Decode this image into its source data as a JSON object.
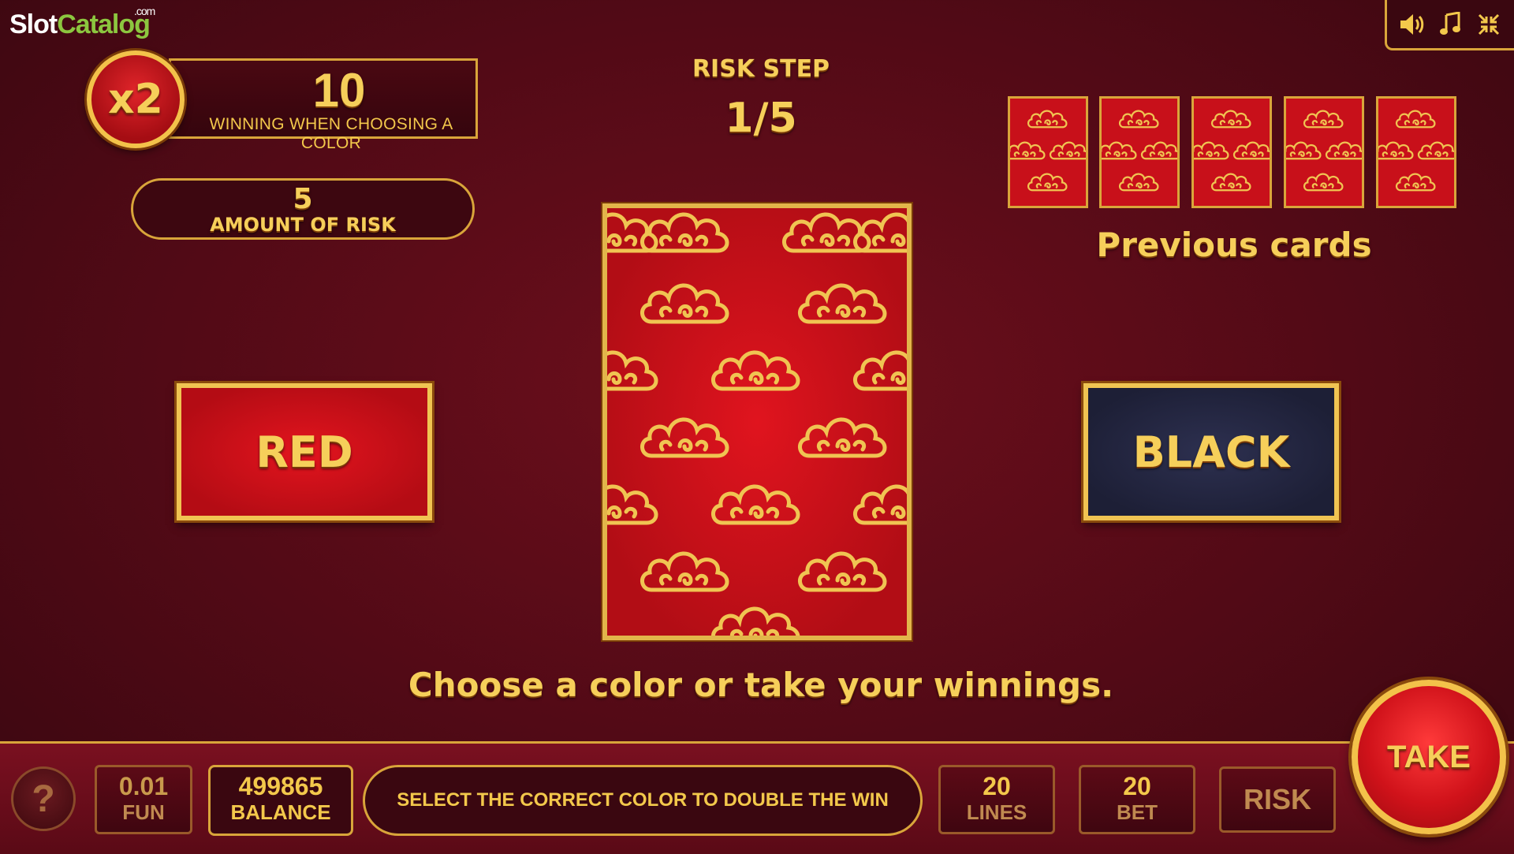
{
  "logo": {
    "slot": "Slot",
    "catalog": "Catalog",
    "com": ".com"
  },
  "header_icons": {
    "sound": "speaker-icon",
    "music": "music-note-icon",
    "minimize": "collapse-icon"
  },
  "multiplier": {
    "badge": "x2",
    "value": "10",
    "caption": "WINNING WHEN CHOOSING A COLOR"
  },
  "risk_amount": {
    "value": "5",
    "caption": "AMOUNT OF RISK"
  },
  "risk_step": {
    "label": "RISK STEP",
    "value": "1/5"
  },
  "previous_cards": {
    "label": "Previous cards",
    "count": 5
  },
  "buttons": {
    "red": "RED",
    "black": "BLACK",
    "take": "TAKE",
    "risk": "RISK",
    "help": "?"
  },
  "instruction": "Choose a color or take your winnings.",
  "bottom_bar": {
    "fun": {
      "value": "0.01",
      "label": "FUN"
    },
    "balance": {
      "value": "499865",
      "label": "BALANCE"
    },
    "message": "SELECT THE CORRECT COLOR TO DOUBLE THE WIN",
    "lines": {
      "value": "20",
      "label": "LINES"
    },
    "bet": {
      "value": "20",
      "label": "BET"
    }
  },
  "colors": {
    "gold": "#f3c84b",
    "red": "#c8101a",
    "dark_red": "#520a16",
    "navy": "#1d1f36"
  }
}
